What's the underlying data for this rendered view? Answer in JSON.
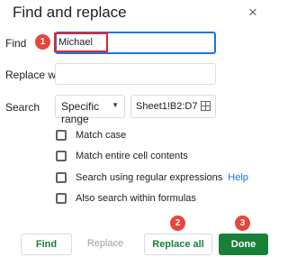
{
  "dialog": {
    "title": "Find and replace",
    "close_glyph": "×"
  },
  "find": {
    "label": "Find",
    "value": "Michael"
  },
  "replace": {
    "label": "Replace with",
    "value": ""
  },
  "search": {
    "label": "Search",
    "scope": "Specific range",
    "range": "Sheet1!B2:D7"
  },
  "options": [
    {
      "label": "Match case",
      "checked": false
    },
    {
      "label": "Match entire cell contents",
      "checked": false
    },
    {
      "label": "Search using regular expressions",
      "checked": false,
      "link": "Help"
    },
    {
      "label": "Also search within formulas",
      "checked": false
    }
  ],
  "buttons": {
    "find": "Find",
    "replace": "Replace",
    "replace_all": "Replace all",
    "done": "Done"
  },
  "annotations": {
    "badge1": "1",
    "badge2": "2",
    "badge3": "3"
  },
  "colors": {
    "accent_blue": "#1a73e8",
    "green": "#188038",
    "annotation_red": "#e8453c"
  },
  "icons": [
    "close-icon",
    "dropdown-arrow-icon",
    "grid-select-icon"
  ]
}
